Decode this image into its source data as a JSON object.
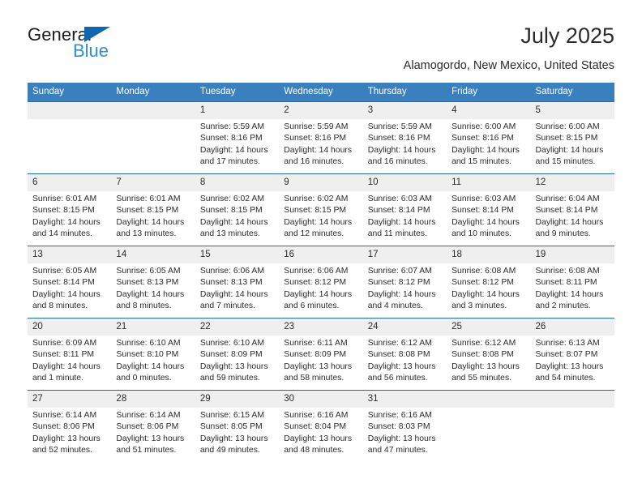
{
  "brand": {
    "name_part1": "General",
    "name_part2": "Blue",
    "triangle_color": "#1067b0",
    "blue_text_color": "#2b8fd6"
  },
  "header": {
    "title": "July 2025",
    "subtitle": "Alamogordo, New Mexico, United States"
  },
  "theme": {
    "header_row_bg": "#3a7fbe",
    "row_divider": "#1f6cb0",
    "daynum_strip_bg": "#efefef",
    "text": "#2b2b2b"
  },
  "weekday_headers": [
    "Sunday",
    "Monday",
    "Tuesday",
    "Wednesday",
    "Thursday",
    "Friday",
    "Saturday"
  ],
  "labels": {
    "sunrise_prefix": "Sunrise:",
    "sunset_prefix": "Sunset:",
    "daylight_prefix": "Daylight:"
  },
  "weeks": [
    [
      {
        "day": "",
        "empty": true
      },
      {
        "day": "",
        "empty": true
      },
      {
        "day": "1",
        "sunrise": "Sunrise: 5:59 AM",
        "sunset": "Sunset: 8:16 PM",
        "daylight_line1": "Daylight: 14 hours",
        "daylight_line2": "and 17 minutes."
      },
      {
        "day": "2",
        "sunrise": "Sunrise: 5:59 AM",
        "sunset": "Sunset: 8:16 PM",
        "daylight_line1": "Daylight: 14 hours",
        "daylight_line2": "and 16 minutes."
      },
      {
        "day": "3",
        "sunrise": "Sunrise: 5:59 AM",
        "sunset": "Sunset: 8:16 PM",
        "daylight_line1": "Daylight: 14 hours",
        "daylight_line2": "and 16 minutes."
      },
      {
        "day": "4",
        "sunrise": "Sunrise: 6:00 AM",
        "sunset": "Sunset: 8:16 PM",
        "daylight_line1": "Daylight: 14 hours",
        "daylight_line2": "and 15 minutes."
      },
      {
        "day": "5",
        "sunrise": "Sunrise: 6:00 AM",
        "sunset": "Sunset: 8:15 PM",
        "daylight_line1": "Daylight: 14 hours",
        "daylight_line2": "and 15 minutes."
      }
    ],
    [
      {
        "day": "6",
        "sunrise": "Sunrise: 6:01 AM",
        "sunset": "Sunset: 8:15 PM",
        "daylight_line1": "Daylight: 14 hours",
        "daylight_line2": "and 14 minutes."
      },
      {
        "day": "7",
        "sunrise": "Sunrise: 6:01 AM",
        "sunset": "Sunset: 8:15 PM",
        "daylight_line1": "Daylight: 14 hours",
        "daylight_line2": "and 13 minutes."
      },
      {
        "day": "8",
        "sunrise": "Sunrise: 6:02 AM",
        "sunset": "Sunset: 8:15 PM",
        "daylight_line1": "Daylight: 14 hours",
        "daylight_line2": "and 13 minutes."
      },
      {
        "day": "9",
        "sunrise": "Sunrise: 6:02 AM",
        "sunset": "Sunset: 8:15 PM",
        "daylight_line1": "Daylight: 14 hours",
        "daylight_line2": "and 12 minutes."
      },
      {
        "day": "10",
        "sunrise": "Sunrise: 6:03 AM",
        "sunset": "Sunset: 8:14 PM",
        "daylight_line1": "Daylight: 14 hours",
        "daylight_line2": "and 11 minutes."
      },
      {
        "day": "11",
        "sunrise": "Sunrise: 6:03 AM",
        "sunset": "Sunset: 8:14 PM",
        "daylight_line1": "Daylight: 14 hours",
        "daylight_line2": "and 10 minutes."
      },
      {
        "day": "12",
        "sunrise": "Sunrise: 6:04 AM",
        "sunset": "Sunset: 8:14 PM",
        "daylight_line1": "Daylight: 14 hours",
        "daylight_line2": "and 9 minutes."
      }
    ],
    [
      {
        "day": "13",
        "sunrise": "Sunrise: 6:05 AM",
        "sunset": "Sunset: 8:14 PM",
        "daylight_line1": "Daylight: 14 hours",
        "daylight_line2": "and 8 minutes."
      },
      {
        "day": "14",
        "sunrise": "Sunrise: 6:05 AM",
        "sunset": "Sunset: 8:13 PM",
        "daylight_line1": "Daylight: 14 hours",
        "daylight_line2": "and 8 minutes."
      },
      {
        "day": "15",
        "sunrise": "Sunrise: 6:06 AM",
        "sunset": "Sunset: 8:13 PM",
        "daylight_line1": "Daylight: 14 hours",
        "daylight_line2": "and 7 minutes."
      },
      {
        "day": "16",
        "sunrise": "Sunrise: 6:06 AM",
        "sunset": "Sunset: 8:12 PM",
        "daylight_line1": "Daylight: 14 hours",
        "daylight_line2": "and 6 minutes."
      },
      {
        "day": "17",
        "sunrise": "Sunrise: 6:07 AM",
        "sunset": "Sunset: 8:12 PM",
        "daylight_line1": "Daylight: 14 hours",
        "daylight_line2": "and 4 minutes."
      },
      {
        "day": "18",
        "sunrise": "Sunrise: 6:08 AM",
        "sunset": "Sunset: 8:12 PM",
        "daylight_line1": "Daylight: 14 hours",
        "daylight_line2": "and 3 minutes."
      },
      {
        "day": "19",
        "sunrise": "Sunrise: 6:08 AM",
        "sunset": "Sunset: 8:11 PM",
        "daylight_line1": "Daylight: 14 hours",
        "daylight_line2": "and 2 minutes."
      }
    ],
    [
      {
        "day": "20",
        "sunrise": "Sunrise: 6:09 AM",
        "sunset": "Sunset: 8:11 PM",
        "daylight_line1": "Daylight: 14 hours",
        "daylight_line2": "and 1 minute."
      },
      {
        "day": "21",
        "sunrise": "Sunrise: 6:10 AM",
        "sunset": "Sunset: 8:10 PM",
        "daylight_line1": "Daylight: 14 hours",
        "daylight_line2": "and 0 minutes."
      },
      {
        "day": "22",
        "sunrise": "Sunrise: 6:10 AM",
        "sunset": "Sunset: 8:09 PM",
        "daylight_line1": "Daylight: 13 hours",
        "daylight_line2": "and 59 minutes."
      },
      {
        "day": "23",
        "sunrise": "Sunrise: 6:11 AM",
        "sunset": "Sunset: 8:09 PM",
        "daylight_line1": "Daylight: 13 hours",
        "daylight_line2": "and 58 minutes."
      },
      {
        "day": "24",
        "sunrise": "Sunrise: 6:12 AM",
        "sunset": "Sunset: 8:08 PM",
        "daylight_line1": "Daylight: 13 hours",
        "daylight_line2": "and 56 minutes."
      },
      {
        "day": "25",
        "sunrise": "Sunrise: 6:12 AM",
        "sunset": "Sunset: 8:08 PM",
        "daylight_line1": "Daylight: 13 hours",
        "daylight_line2": "and 55 minutes."
      },
      {
        "day": "26",
        "sunrise": "Sunrise: 6:13 AM",
        "sunset": "Sunset: 8:07 PM",
        "daylight_line1": "Daylight: 13 hours",
        "daylight_line2": "and 54 minutes."
      }
    ],
    [
      {
        "day": "27",
        "sunrise": "Sunrise: 6:14 AM",
        "sunset": "Sunset: 8:06 PM",
        "daylight_line1": "Daylight: 13 hours",
        "daylight_line2": "and 52 minutes."
      },
      {
        "day": "28",
        "sunrise": "Sunrise: 6:14 AM",
        "sunset": "Sunset: 8:06 PM",
        "daylight_line1": "Daylight: 13 hours",
        "daylight_line2": "and 51 minutes."
      },
      {
        "day": "29",
        "sunrise": "Sunrise: 6:15 AM",
        "sunset": "Sunset: 8:05 PM",
        "daylight_line1": "Daylight: 13 hours",
        "daylight_line2": "and 49 minutes."
      },
      {
        "day": "30",
        "sunrise": "Sunrise: 6:16 AM",
        "sunset": "Sunset: 8:04 PM",
        "daylight_line1": "Daylight: 13 hours",
        "daylight_line2": "and 48 minutes."
      },
      {
        "day": "31",
        "sunrise": "Sunrise: 6:16 AM",
        "sunset": "Sunset: 8:03 PM",
        "daylight_line1": "Daylight: 13 hours",
        "daylight_line2": "and 47 minutes."
      },
      {
        "day": "",
        "empty": true
      },
      {
        "day": "",
        "empty": true
      }
    ]
  ]
}
